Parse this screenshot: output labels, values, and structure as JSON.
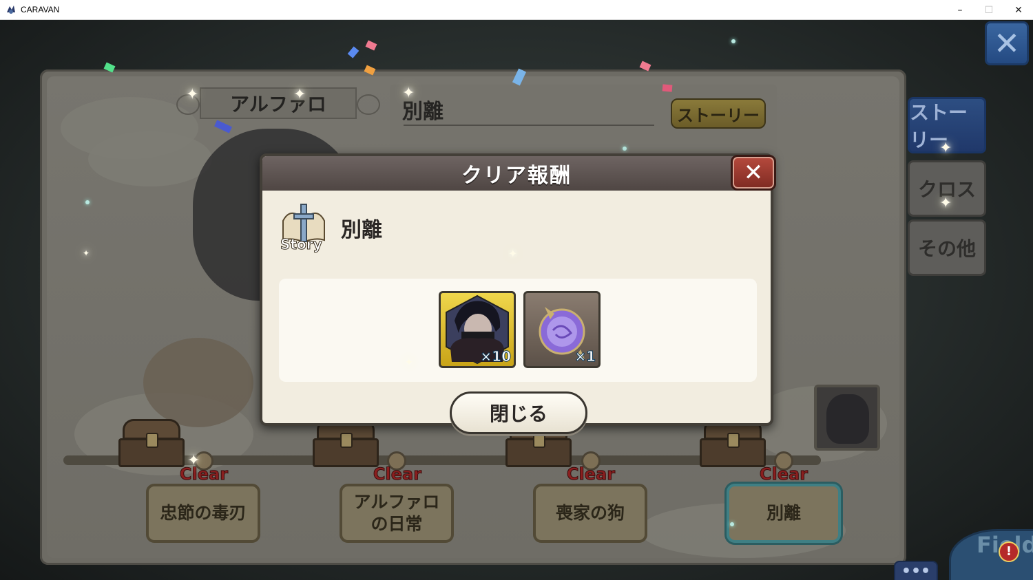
{
  "window": {
    "title": "CARAVAN",
    "minimize": "–",
    "maximize": "☐",
    "close": "✕"
  },
  "panel": {
    "chapter_name": "アルファロ",
    "story_title": "別離",
    "story_button": "ストーリー"
  },
  "side_tabs": [
    {
      "label": "ストーリー",
      "active": true
    },
    {
      "label": "クロス",
      "active": false
    },
    {
      "label": "その他",
      "active": false
    }
  ],
  "close_icon": "close-icon",
  "stages": [
    {
      "clear": "Clear",
      "name": "忠節の毒刃"
    },
    {
      "clear": "Clear",
      "name": "アルファロ\nの日常"
    },
    {
      "clear": "Clear",
      "name": "喪家の狗"
    },
    {
      "clear": "Clear",
      "name": "別離",
      "selected": true
    }
  ],
  "modal": {
    "title": "クリア報酬",
    "close_icon": "close-icon",
    "story_badge": "Story",
    "stage_name": "別離",
    "rewards": [
      {
        "icon": "character-shard-icon",
        "count": "×10"
      },
      {
        "icon": "purple-orb-icon",
        "count": "×1"
      }
    ],
    "close_button": "閉じる"
  },
  "bottom": {
    "more": "•••",
    "field": "Field",
    "alert": "!"
  },
  "colors": {
    "accent_blue": "#2d4e82",
    "clear_red": "#8a1f1f",
    "modal_bg": "#f2ede0",
    "modal_header": "#5e5452"
  }
}
